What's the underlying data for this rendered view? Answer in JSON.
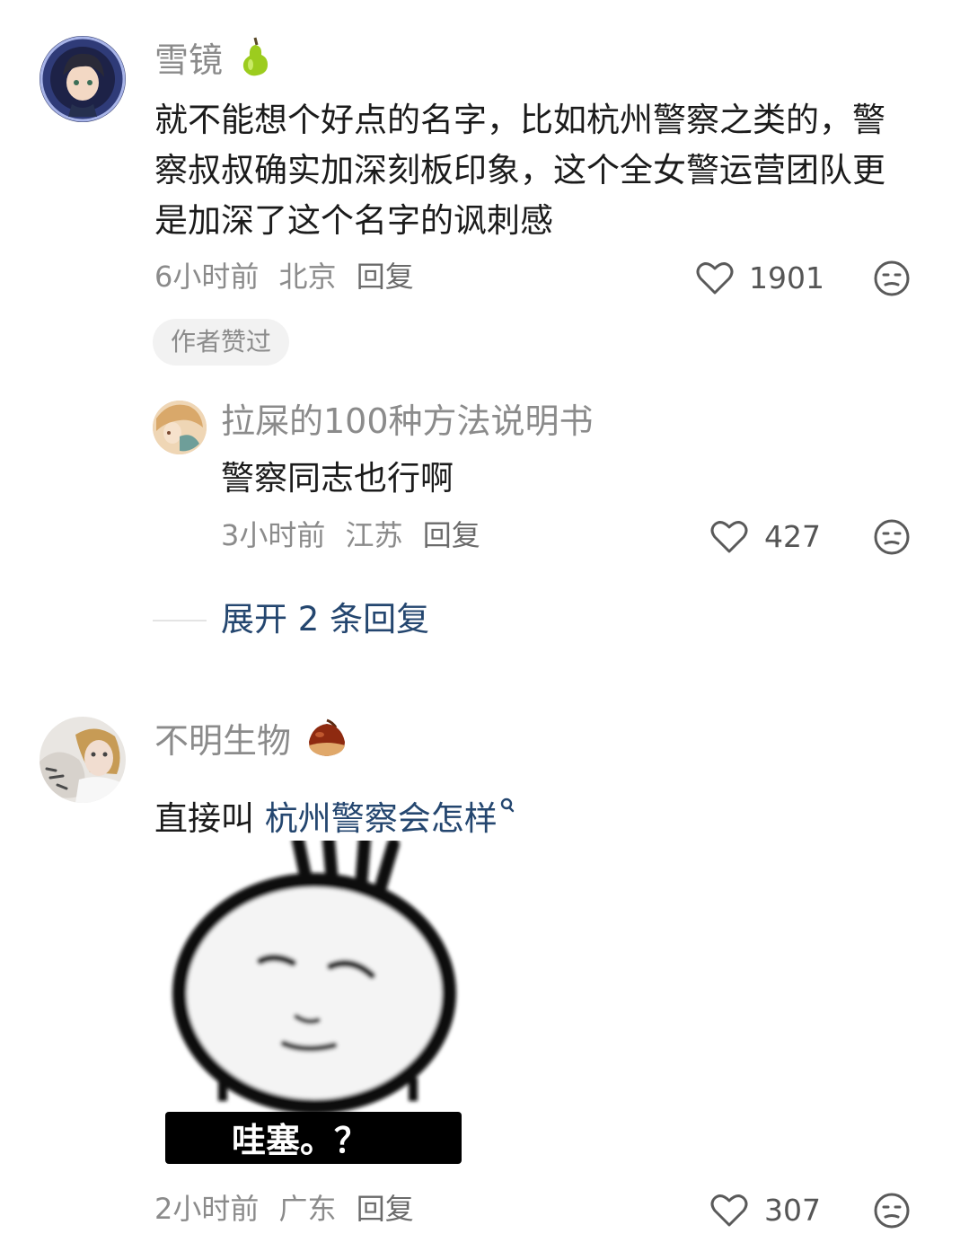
{
  "comments": [
    {
      "username": "雪镜",
      "badge_icon": "pear-icon",
      "text": "就不能想个好点的名字，比如杭州警察之类的，警察叔叔确实加深刻板印象，这个全女警运营团队更是加深了这个名字的讽刺感",
      "time": "6小时前",
      "location": "北京",
      "reply_label": "回复",
      "likes": "1901",
      "author_liked": "作者赞过",
      "replies": [
        {
          "username": "拉屎的100种方法说明书",
          "text": "警察同志也行啊",
          "time": "3小时前",
          "location": "江苏",
          "reply_label": "回复",
          "likes": "427"
        }
      ],
      "expand_label": "展开 2 条回复"
    },
    {
      "username": "不明生物",
      "badge_icon": "chestnut-icon",
      "text_prefix": "直接叫 ",
      "text_link": "杭州警察会怎样",
      "sticker_caption": "哇塞。？",
      "time": "2小时前",
      "location": "广东",
      "reply_label": "回复",
      "likes": "307"
    }
  ],
  "colors": {
    "link": "#24466f",
    "meta": "#8b8b8b"
  }
}
